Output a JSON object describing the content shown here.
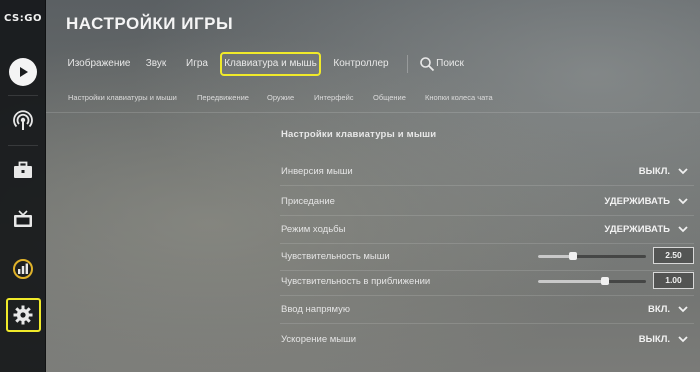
{
  "logo": {
    "text": "CS:GO"
  },
  "header": {
    "title": "НАСТРОЙКИ ИГРЫ"
  },
  "tabs": [
    {
      "label": "Изображение",
      "active": false
    },
    {
      "label": "Звук",
      "active": false
    },
    {
      "label": "Игра",
      "active": false
    },
    {
      "label": "Клавиатура и мышь",
      "active": true
    },
    {
      "label": "Контроллер",
      "active": false
    }
  ],
  "search": {
    "label": "Поиск",
    "icon": "search-icon"
  },
  "subtabs": [
    "Настройки клавиатуры и мыши",
    "Передвижение",
    "Оружие",
    "Интерфейс",
    "Общение",
    "Кнопки колеса чата"
  ],
  "sidebar": {
    "items": [
      {
        "icon": "play-icon"
      },
      {
        "icon": "broadcast-icon"
      },
      {
        "icon": "briefcase-icon"
      },
      {
        "icon": "tv-icon"
      },
      {
        "icon": "stats-icon"
      },
      {
        "icon": "gear-icon",
        "highlighted": true
      }
    ]
  },
  "section": {
    "title": "Настройки клавиатуры и мыши"
  },
  "settings": [
    {
      "label": "Инверсия мыши",
      "type": "dropdown",
      "value": "ВЫКЛ."
    },
    {
      "label": "Приседание",
      "type": "dropdown",
      "value": "УДЕРЖИВАТЬ"
    },
    {
      "label": "Режим ходьбы",
      "type": "dropdown",
      "value": "УДЕРЖИВАТЬ"
    },
    {
      "label": "Чувствительность мыши",
      "type": "slider",
      "value": "2.50",
      "fraction": 0.32
    },
    {
      "label": "Чувствительность в приближении",
      "type": "slider",
      "value": "1.00",
      "fraction": 0.62
    },
    {
      "label": "Ввод напрямую",
      "type": "dropdown",
      "value": "ВКЛ."
    },
    {
      "label": "Ускорение мыши",
      "type": "dropdown",
      "value": "ВЫКЛ."
    }
  ],
  "colors": {
    "highlight": "#f0ea2a",
    "sidebar": "#16181a"
  }
}
